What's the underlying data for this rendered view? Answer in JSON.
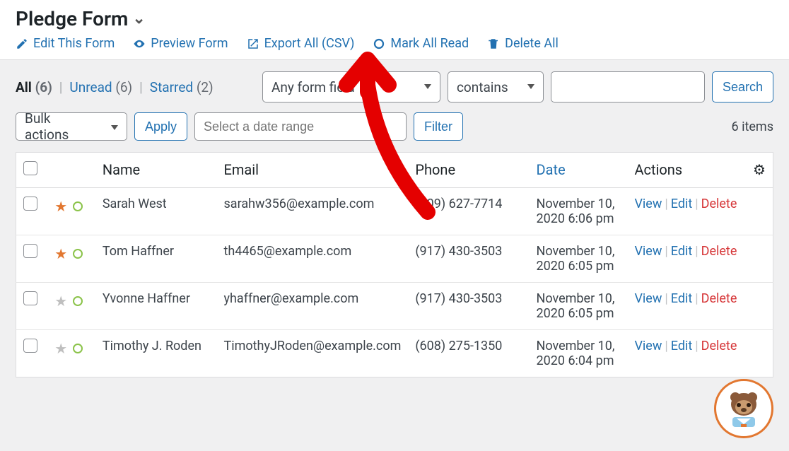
{
  "header": {
    "title": "Pledge Form",
    "links": {
      "edit": "Edit This Form",
      "preview": "Preview Form",
      "export": "Export All (CSV)",
      "markread": "Mark All Read",
      "deleteall": "Delete All"
    }
  },
  "filters": {
    "tabs": {
      "all_label": "All",
      "all_count": "(6)",
      "unread_label": "Unread",
      "unread_count": "(6)",
      "starred_label": "Starred",
      "starred_count": "(2)"
    },
    "field_select": "Any form field",
    "op_select": "contains",
    "search_value": "",
    "search_btn": "Search",
    "bulk_select": "Bulk actions",
    "apply_btn": "Apply",
    "date_placeholder": "Select a date range",
    "filter_btn": "Filter",
    "items_count": "6 items"
  },
  "table": {
    "headers": {
      "name": "Name",
      "email": "Email",
      "phone": "Phone",
      "date": "Date",
      "actions": "Actions"
    },
    "row_actions": {
      "view": "View",
      "edit": "Edit",
      "delete": "Delete"
    },
    "rows": [
      {
        "starred": true,
        "name": "Sarah West",
        "email": "sarahw356@example.com",
        "phone": "(209) 627-7714",
        "date": "November 10, 2020 6:06 pm"
      },
      {
        "starred": true,
        "name": "Tom Haffner",
        "email": "th4465@example.com",
        "phone": "(917) 430-3503",
        "date": "November 10, 2020 6:05 pm"
      },
      {
        "starred": false,
        "name": "Yvonne Haffner",
        "email": "yhaffner@example.com",
        "phone": "(917) 430-3503",
        "date": "November 10, 2020 6:05 pm"
      },
      {
        "starred": false,
        "name": "Timothy J. Roden",
        "email": "TimothyJRoden@example.com",
        "phone": "(608) 275-1350",
        "date": "November 10, 2020 6:04 pm"
      }
    ]
  }
}
